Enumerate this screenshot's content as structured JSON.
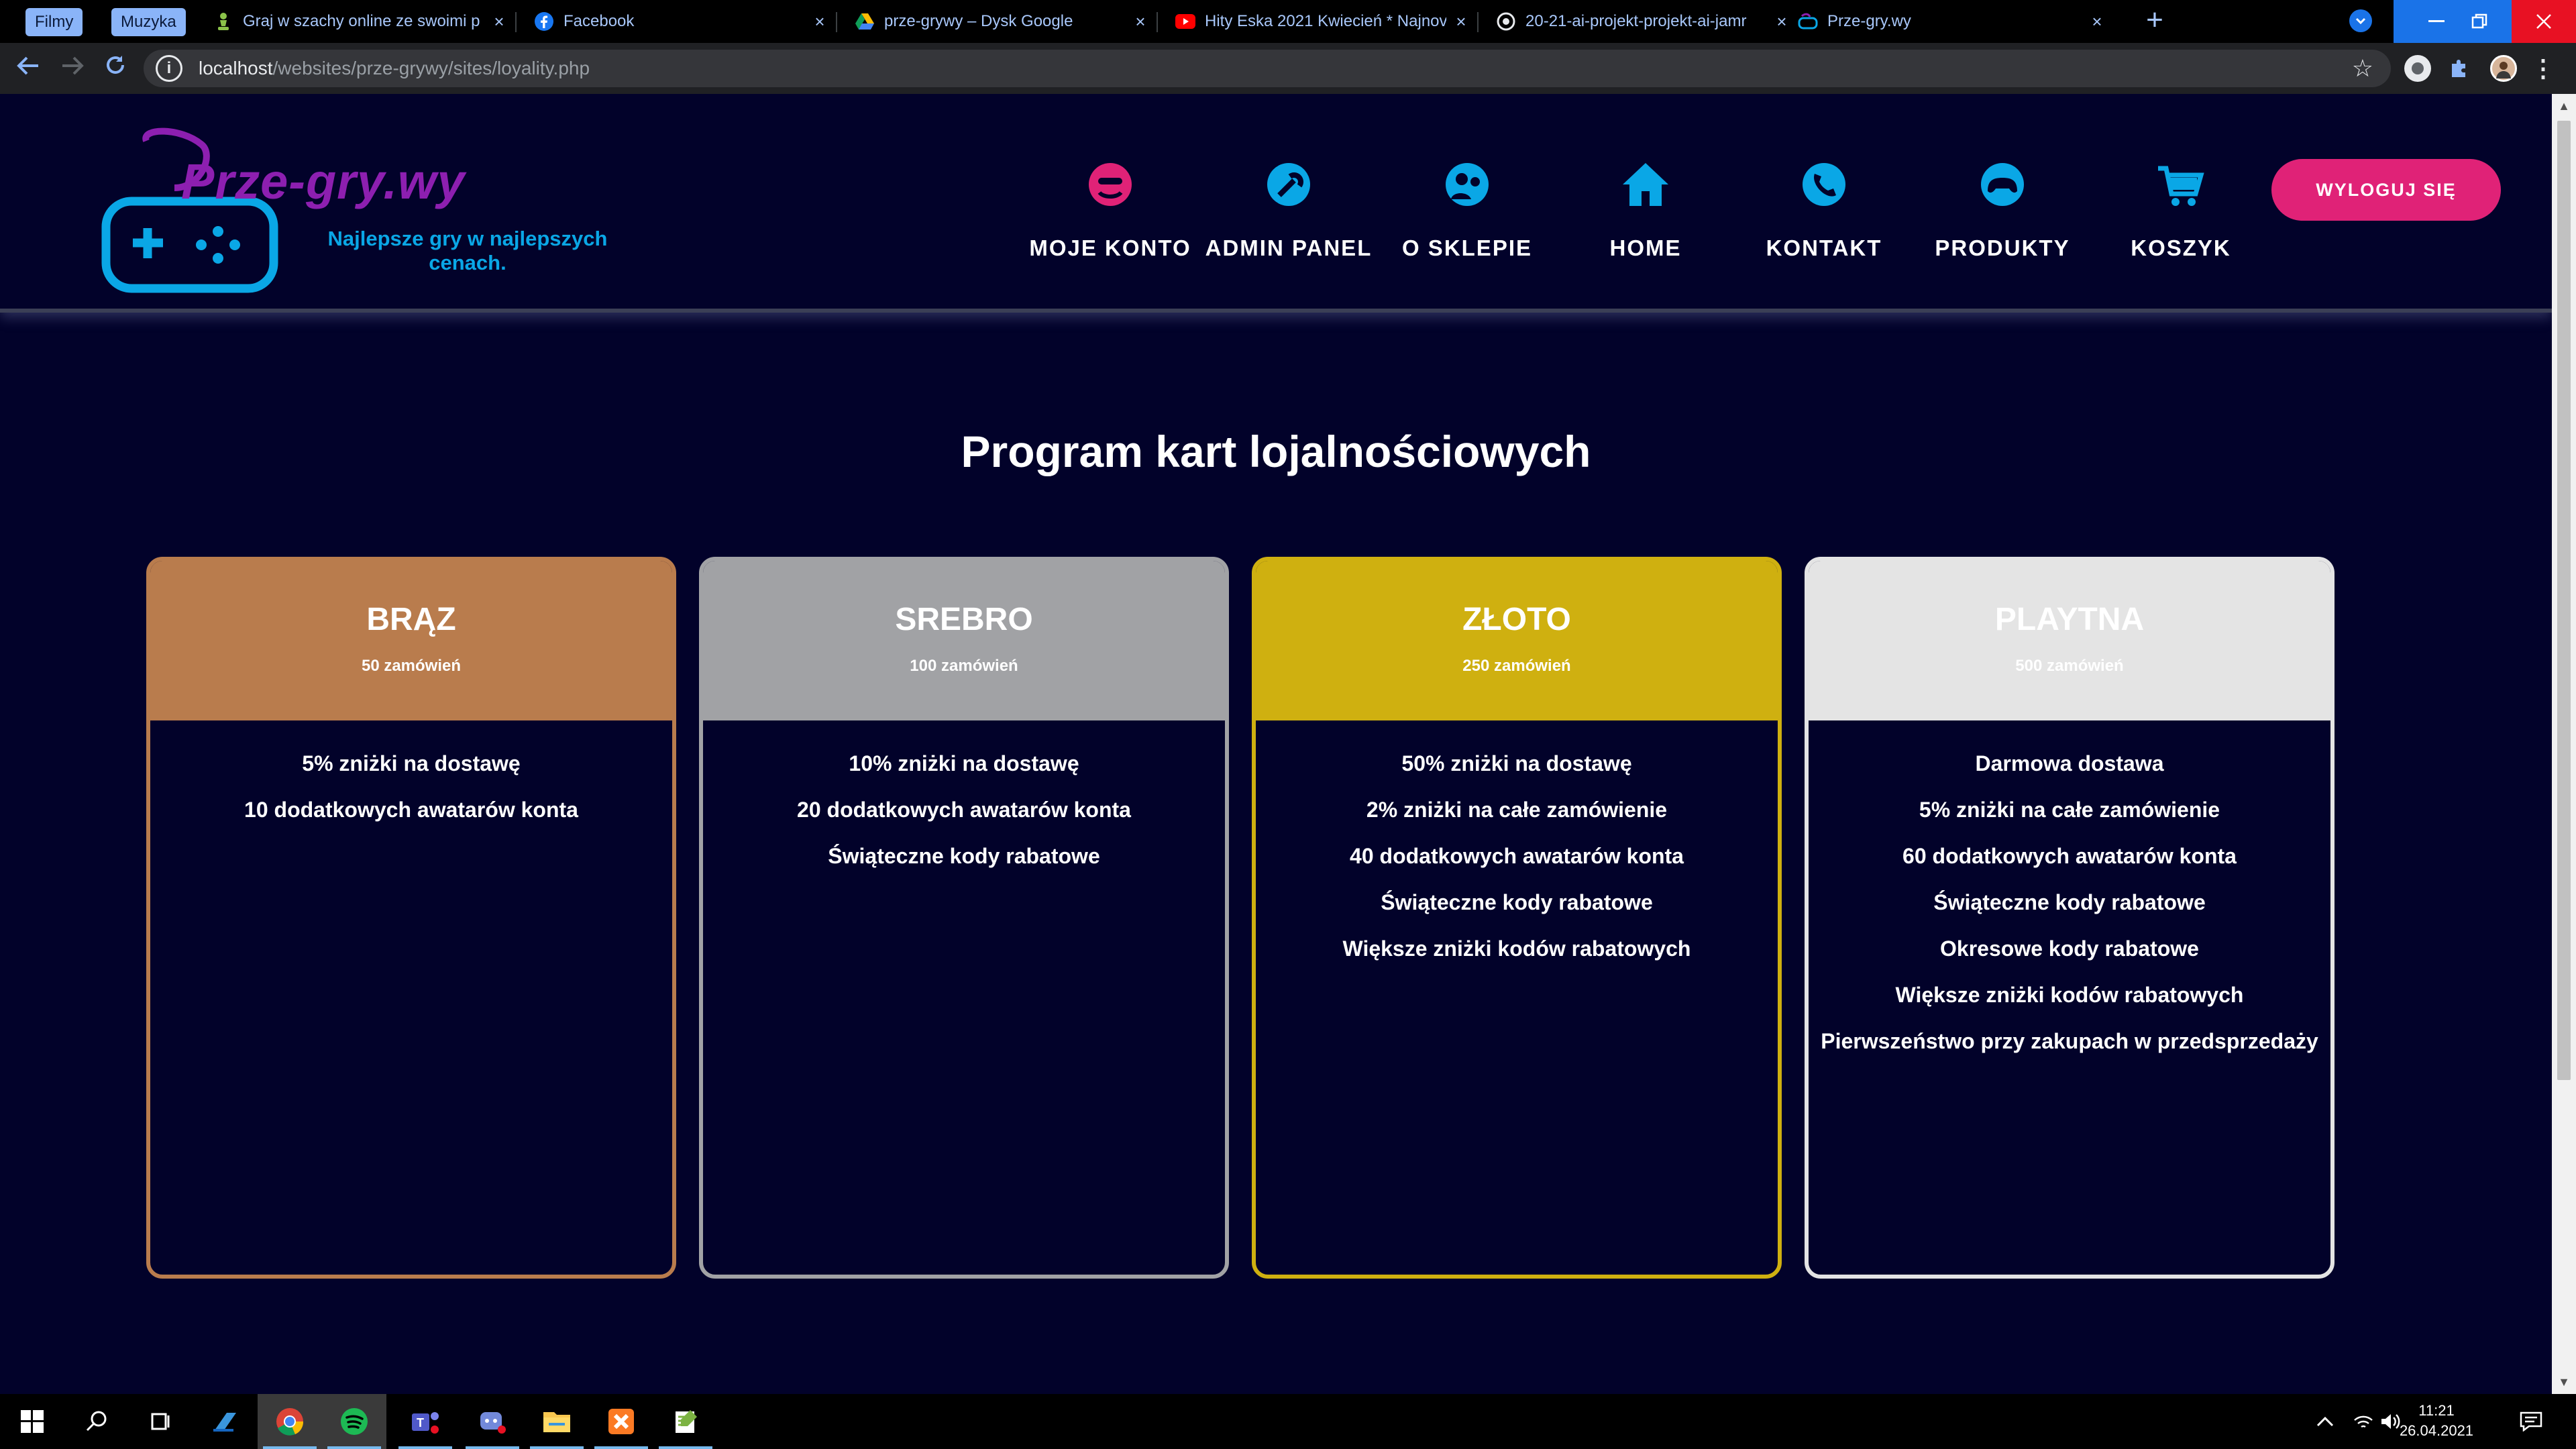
{
  "browser": {
    "bookmarks": [
      "Filmy",
      "Muzyka"
    ],
    "tabs": [
      {
        "title": "Graj w szachy online ze swoimi p",
        "icon": "chess-pawn-icon"
      },
      {
        "title": "Facebook",
        "icon": "facebook-icon"
      },
      {
        "title": "prze-grywy – Dysk Google",
        "icon": "google-drive-icon"
      },
      {
        "title": "Hity Eska 2021 Kwiecień * Najnov",
        "icon": "youtube-icon"
      },
      {
        "title": "20-21-ai-projekt-projekt-ai-jamr",
        "icon": "github-icon"
      },
      {
        "title": "Prze-gry.wy",
        "icon": "gamepad-icon"
      }
    ],
    "url_host": "localhost",
    "url_path": "/websites/prze-grywy/sites/loyality.php"
  },
  "site": {
    "logo_title": "Prze-gry.wy",
    "logo_subtitle": "Najlepsze gry w najlepszych cenach.",
    "nav": [
      {
        "label": "MOJE KONTO",
        "icon": "account-icon"
      },
      {
        "label": "ADMIN PANEL",
        "icon": "admin-wrench-icon"
      },
      {
        "label": "O SKLEPIE",
        "icon": "people-icon"
      },
      {
        "label": "HOME",
        "icon": "home-icon"
      },
      {
        "label": "KONTAKT",
        "icon": "phone-icon"
      },
      {
        "label": "PRODUKTY",
        "icon": "controller-icon"
      },
      {
        "label": "KOSZYK",
        "icon": "cart-icon"
      }
    ],
    "logout_label": "WYLOGUJ SIĘ"
  },
  "main": {
    "title": "Program kart lojalnościowych",
    "cards": [
      {
        "name": "BRĄZ",
        "orders": "50 zamówień",
        "color": "#b97c4d",
        "perks": [
          "5% zniżki na dostawę",
          "10 dodatkowych awatarów konta"
        ]
      },
      {
        "name": "SREBRO",
        "orders": "100 zamówień",
        "color": "#a1a2a5",
        "perks": [
          "10% zniżki na dostawę",
          "20 dodatkowych awatarów konta",
          "Świąteczne kody rabatowe"
        ]
      },
      {
        "name": "ZŁOTO",
        "orders": "250 zamówień",
        "color": "#cfb010",
        "perks": [
          "50% zniżki na dostawę",
          "2% zniżki na całe zamówienie",
          "40 dodatkowych awatarów konta",
          "Świąteczne kody rabatowe",
          "Większe zniżki kodów rabatowych"
        ]
      },
      {
        "name": "PLAYTNA",
        "orders": "500 zamówień",
        "color": "#e4e4e4",
        "perks": [
          "Darmowa dostawa",
          "5% zniżki na całe zamówienie",
          "60 dodatkowych awatarów konta",
          "Świąteczne kody rabatowe",
          "Okresowe kody rabatowe",
          "Większe zniżki kodów rabatowych",
          "Pierwszeństwo przy zakupach w przedsprzedaży"
        ]
      }
    ]
  },
  "taskbar": {
    "apps": [
      "windows-start-icon",
      "search-icon",
      "task-view-icon",
      "file-manager-icon",
      "chrome-icon",
      "spotify-icon",
      "teams-icon",
      "discord-icon",
      "file-explorer-icon",
      "xampp-icon",
      "notepad-plus-icon"
    ],
    "time": "11:21",
    "date": "26.04.2021"
  }
}
